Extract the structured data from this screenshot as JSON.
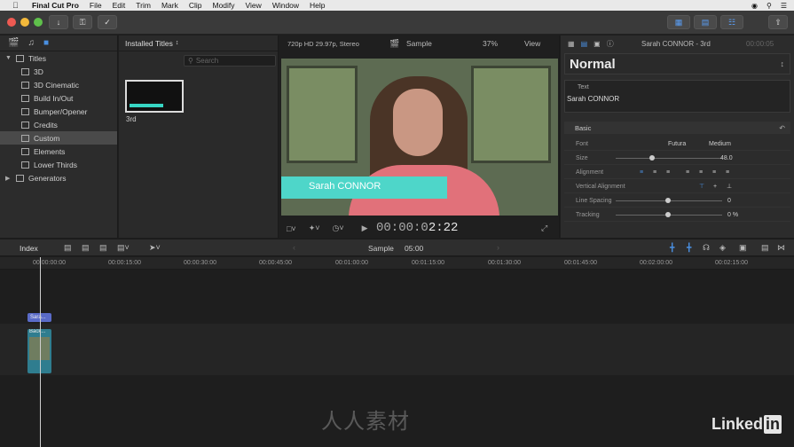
{
  "menubar": {
    "app": "Final Cut Pro",
    "items": [
      "File",
      "Edit",
      "Trim",
      "Mark",
      "Clip",
      "Modify",
      "View",
      "Window",
      "Help"
    ]
  },
  "browser": {
    "sidebar": {
      "root": "Titles",
      "items": [
        "3D",
        "3D Cinematic",
        "Build In/Out",
        "Bumper/Opener",
        "Credits",
        "Custom",
        "Elements",
        "Lower Thirds"
      ],
      "selected": "Custom",
      "generators": "Generators"
    },
    "header": "Installed Titles",
    "search_placeholder": "Search",
    "thumb_label": "3rd"
  },
  "viewer": {
    "format": "720p HD 29.97p, Stereo",
    "name": "Sample",
    "zoom": "37%",
    "view_menu": "View",
    "lower_third_text": "Sarah CONNOR",
    "timecode_dim": "00:00:0",
    "timecode_bright": "2:22"
  },
  "inspector": {
    "clip_name": "Sarah CONNOR - 3rd",
    "clip_tc": "00:00:05",
    "preset": "Normal",
    "text_label": "Text",
    "text_value": "Sarah CONNOR",
    "section": "Basic",
    "props": {
      "font_label": "Font",
      "font_value": "Futura",
      "font_weight": "Medium",
      "size_label": "Size",
      "size_value": "48.0",
      "alignment_label": "Alignment",
      "valign_label": "Vertical Alignment",
      "spacing_label": "Line Spacing",
      "spacing_value": "0",
      "tracking_label": "Tracking",
      "tracking_value": "0 %"
    }
  },
  "timeline": {
    "index": "Index",
    "project": "Sample",
    "duration": "05:00",
    "ruler": [
      "00:00:00:00",
      "00:00:15:00",
      "00:00:30:00",
      "00:00:45:00",
      "00:01:00:00",
      "00:01:15:00",
      "00:01:30:00",
      "00:01:45:00",
      "00:02:00:00",
      "00:02:15:00"
    ],
    "title_clip": "Sara...",
    "video_clip": "Back..."
  },
  "watermark": "人人素材",
  "brand": {
    "text": "Linked",
    "box": "in"
  }
}
